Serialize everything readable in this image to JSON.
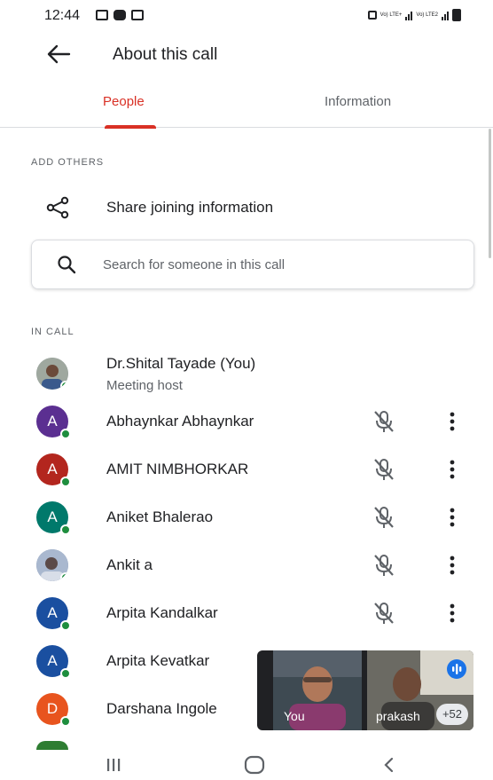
{
  "status_bar": {
    "time": "12:44",
    "network_text_1": "Vo) LTE+",
    "network_text_2": "Vo) LTE2"
  },
  "header": {
    "title": "About this call",
    "back_icon": "arrow-back-icon"
  },
  "tabs": [
    {
      "label": "People",
      "active": true
    },
    {
      "label": "Information",
      "active": false
    }
  ],
  "colors": {
    "accent": "#d93025",
    "online": "#1e8e3e",
    "text": "#202124",
    "secondary_text": "#5f6368"
  },
  "add_others": {
    "section_label": "ADD OTHERS",
    "share_label": "Share joining information",
    "share_icon": "share-icon",
    "search_placeholder": "Search for someone in this call",
    "search_icon": "search-icon"
  },
  "in_call": {
    "section_label": "IN CALL",
    "participants": [
      {
        "name": "Dr.Shital Tayade (You)",
        "subtitle": "Meeting host",
        "avatar": "photo",
        "avatar_color": "#8d9b9a"
      },
      {
        "name": "Abhaynkar Abhaynkar",
        "initial": "A",
        "avatar_color": "#5b2f91",
        "muted": true
      },
      {
        "name": "AMIT NIMBHORKAR",
        "initial": "A",
        "avatar_color": "#b3261e",
        "muted": true
      },
      {
        "name": "Aniket Bhalerao",
        "initial": "A",
        "avatar_color": "#00796b",
        "muted": true
      },
      {
        "name": "Ankit a",
        "avatar": "photo",
        "avatar_color": "#7b8fb1",
        "muted": true
      },
      {
        "name": "Arpita Kandalkar",
        "initial": "A",
        "avatar_color": "#1a4fa0",
        "muted": true
      },
      {
        "name": "Arpita Kevatkar",
        "initial": "A",
        "avatar_color": "#1a4fa0"
      },
      {
        "name": "Darshana Ingole",
        "initial": "D",
        "avatar_color": "#e8541e"
      }
    ]
  },
  "self_view": {
    "you_label": "You",
    "other_label": "prakash",
    "extra_count": "+52"
  },
  "nav_bar": {
    "recents_icon": "recents-icon",
    "home_icon": "home-icon",
    "back_icon": "nav-back-icon"
  }
}
